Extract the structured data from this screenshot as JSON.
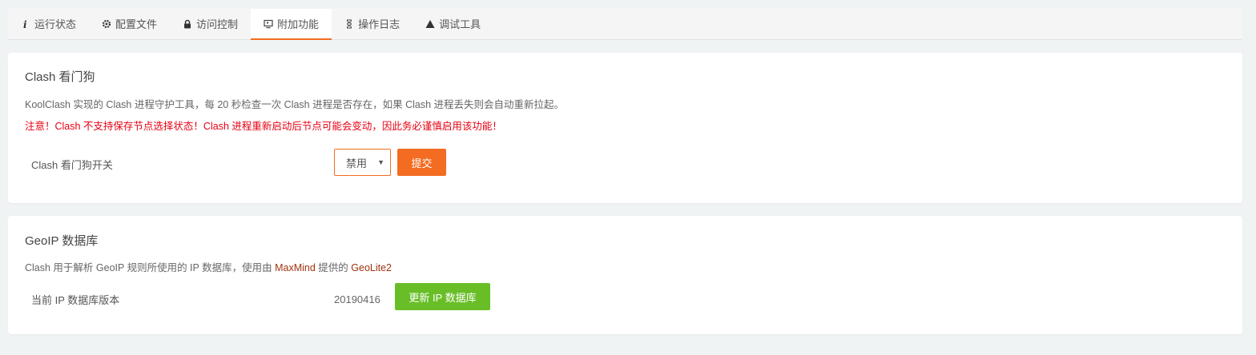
{
  "tabs": [
    {
      "label": "运行状态",
      "icon": "info-icon"
    },
    {
      "label": "配置文件",
      "icon": "gear-icon"
    },
    {
      "label": "访问控制",
      "icon": "lock-icon"
    },
    {
      "label": "附加功能",
      "icon": "monitor-icon",
      "active": true
    },
    {
      "label": "操作日志",
      "icon": "hourglass-icon"
    },
    {
      "label": "调试工具",
      "icon": "warning-icon"
    }
  ],
  "watchdog": {
    "title": "Clash 看门狗",
    "desc": "KoolClash 实现的 Clash 进程守护工具，每 20 秒检查一次 Clash 进程是否存在，如果 Clash 进程丢失则会自动重新拉起。",
    "warning": "注意！Clash 不支持保存节点选择状态！Clash 进程重新启动后节点可能会变动，因此务必谨慎启用该功能！",
    "switch_label": "Clash 看门狗开关",
    "select_value": "禁用",
    "submit_label": "提交"
  },
  "geoip": {
    "title": "GeoIP 数据库",
    "desc_prefix": "Clash 用于解析 GeoIP 规则所使用的 IP 数据库，使用由 ",
    "link_maxmind": "MaxMind",
    "desc_middle": " 提供的 ",
    "link_geolite": "GeoLite2",
    "version_label": "当前 IP 数据库版本",
    "version_value": "20190416",
    "update_label": "更新 IP 数据库"
  },
  "colors": {
    "accent": "#f36c21",
    "warning_text": "#e60012",
    "success_button": "#69be28",
    "link": "#a0320f"
  }
}
